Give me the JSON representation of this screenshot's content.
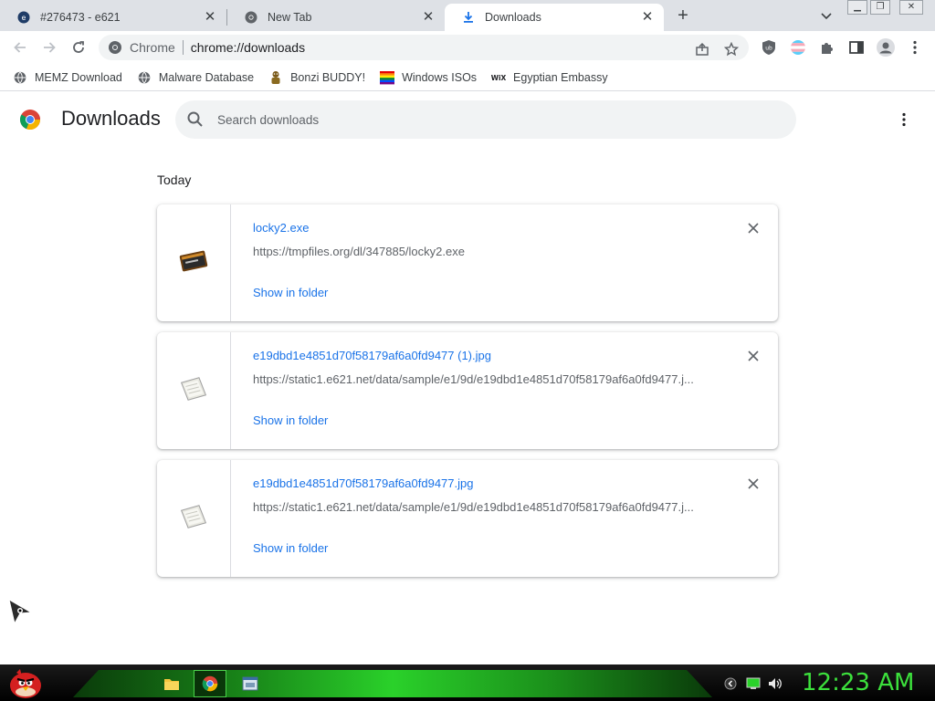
{
  "tabs": [
    {
      "title": "#276473 - e621",
      "favicon": "e621-icon",
      "active": false
    },
    {
      "title": "New Tab",
      "favicon": "chrome-icon",
      "active": false
    },
    {
      "title": "Downloads",
      "favicon": "download-icon",
      "active": true
    }
  ],
  "omnibox": {
    "chip_label": "Chrome",
    "url": "chrome://downloads"
  },
  "bookmarks": [
    {
      "label": "MEMZ Download",
      "icon": "globe-icon"
    },
    {
      "label": "Malware Database",
      "icon": "globe-icon"
    },
    {
      "label": "Bonzi BUDDY!",
      "icon": "bonzi-icon"
    },
    {
      "label": "Windows ISOs",
      "icon": "windows-flag-icon"
    },
    {
      "label": "Egyptian Embassy",
      "icon": "wix-icon"
    }
  ],
  "page": {
    "title": "Downloads",
    "search_placeholder": "Search downloads",
    "section_label": "Today"
  },
  "downloads": [
    {
      "file_name": "locky2.exe",
      "url": "https://tmpfiles.org/dl/347885/locky2.exe",
      "action": "Show in folder",
      "icon": "exe-file-icon"
    },
    {
      "file_name": "e19dbd1e4851d70f58179af6a0fd9477 (1).jpg",
      "url": "https://static1.e621.net/data/sample/e1/9d/e19dbd1e4851d70f58179af6a0fd9477.j...",
      "action": "Show in folder",
      "icon": "image-file-icon"
    },
    {
      "file_name": "e19dbd1e4851d70f58179af6a0fd9477.jpg",
      "url": "https://static1.e621.net/data/sample/e1/9d/e19dbd1e4851d70f58179af6a0fd9477.j...",
      "action": "Show in folder",
      "icon": "image-file-icon"
    }
  ],
  "taskbar": {
    "clock": "12:23 AM",
    "accent_color": "#3ce03c"
  },
  "colors": {
    "link_blue": "#1a73e8",
    "tabstrip_bg": "#dee1e6"
  }
}
